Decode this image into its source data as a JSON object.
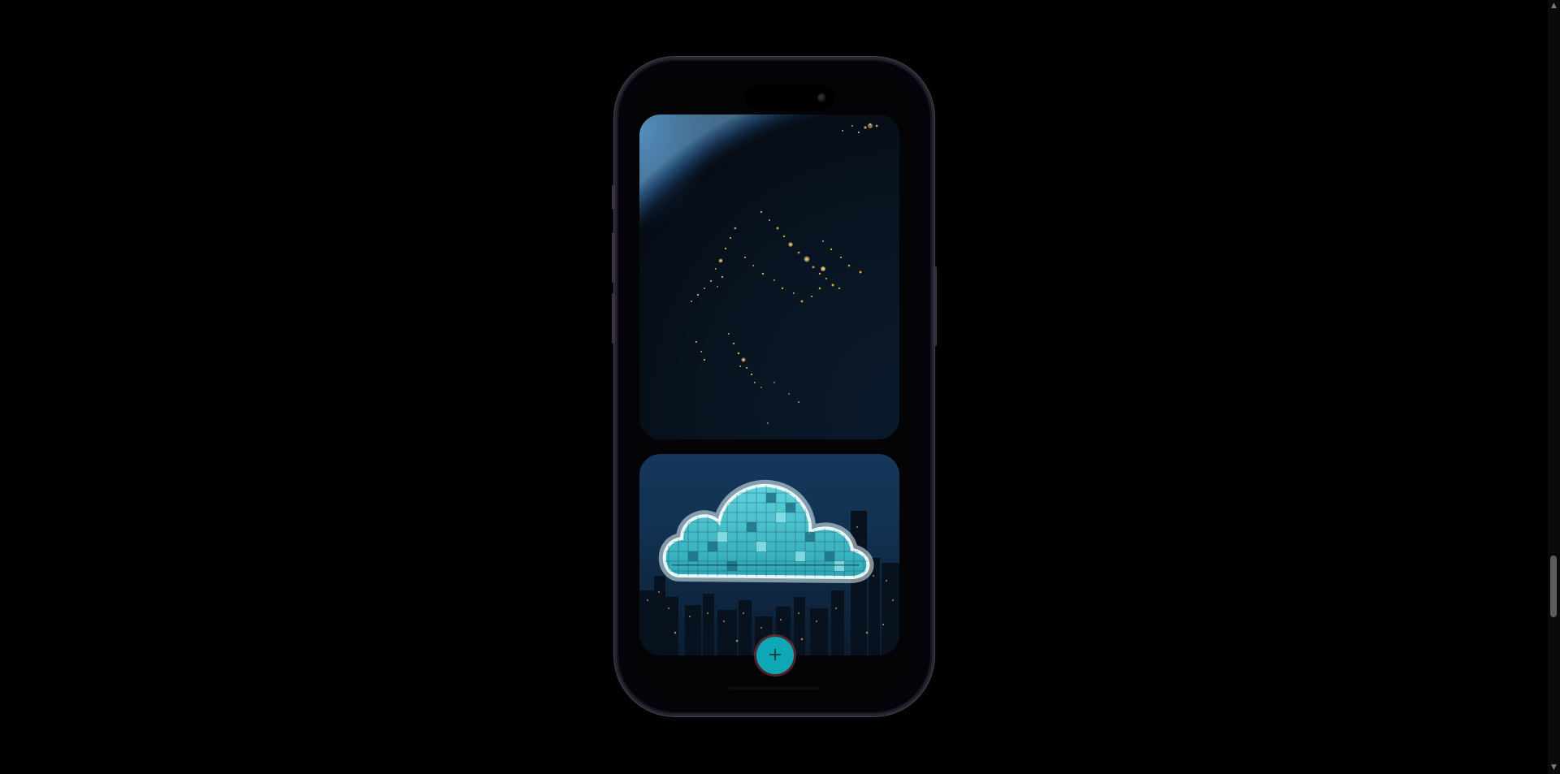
{
  "page": {
    "background_color": "#000000"
  },
  "scrollbar": {
    "up_icon": "triangle-up-icon",
    "down_icon": "triangle-down-icon",
    "position_fraction": 0.79
  },
  "phone": {
    "frame_color": "#4a3e52",
    "screen": {
      "cards": [
        {
          "image": "earth-at-night"
        },
        {
          "image": "cloud-over-city-skyline"
        }
      ],
      "add_button": {
        "icon": "plus-icon",
        "label": "+",
        "color": "#0fa7b6"
      }
    }
  }
}
